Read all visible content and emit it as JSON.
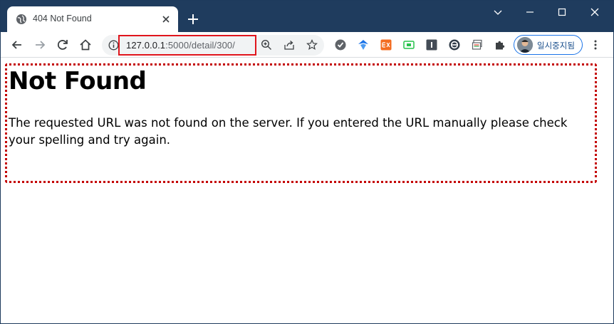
{
  "tab": {
    "title": "404 Not Found",
    "favicon": "globe-icon"
  },
  "address_bar": {
    "url_host": "127.0.0.1",
    "url_path": ":5000/detail/300/"
  },
  "profile": {
    "label": "일시중지됨"
  },
  "page": {
    "heading": "Not Found",
    "message": "The requested URL was not found on the server. If you entered the URL manually please check your spelling and try again."
  },
  "colors": {
    "titlebar": "#1f3c5e",
    "highlight_box": "#e0151c",
    "focus_outline": "#c40000",
    "profile_accent": "#1a73e8"
  }
}
